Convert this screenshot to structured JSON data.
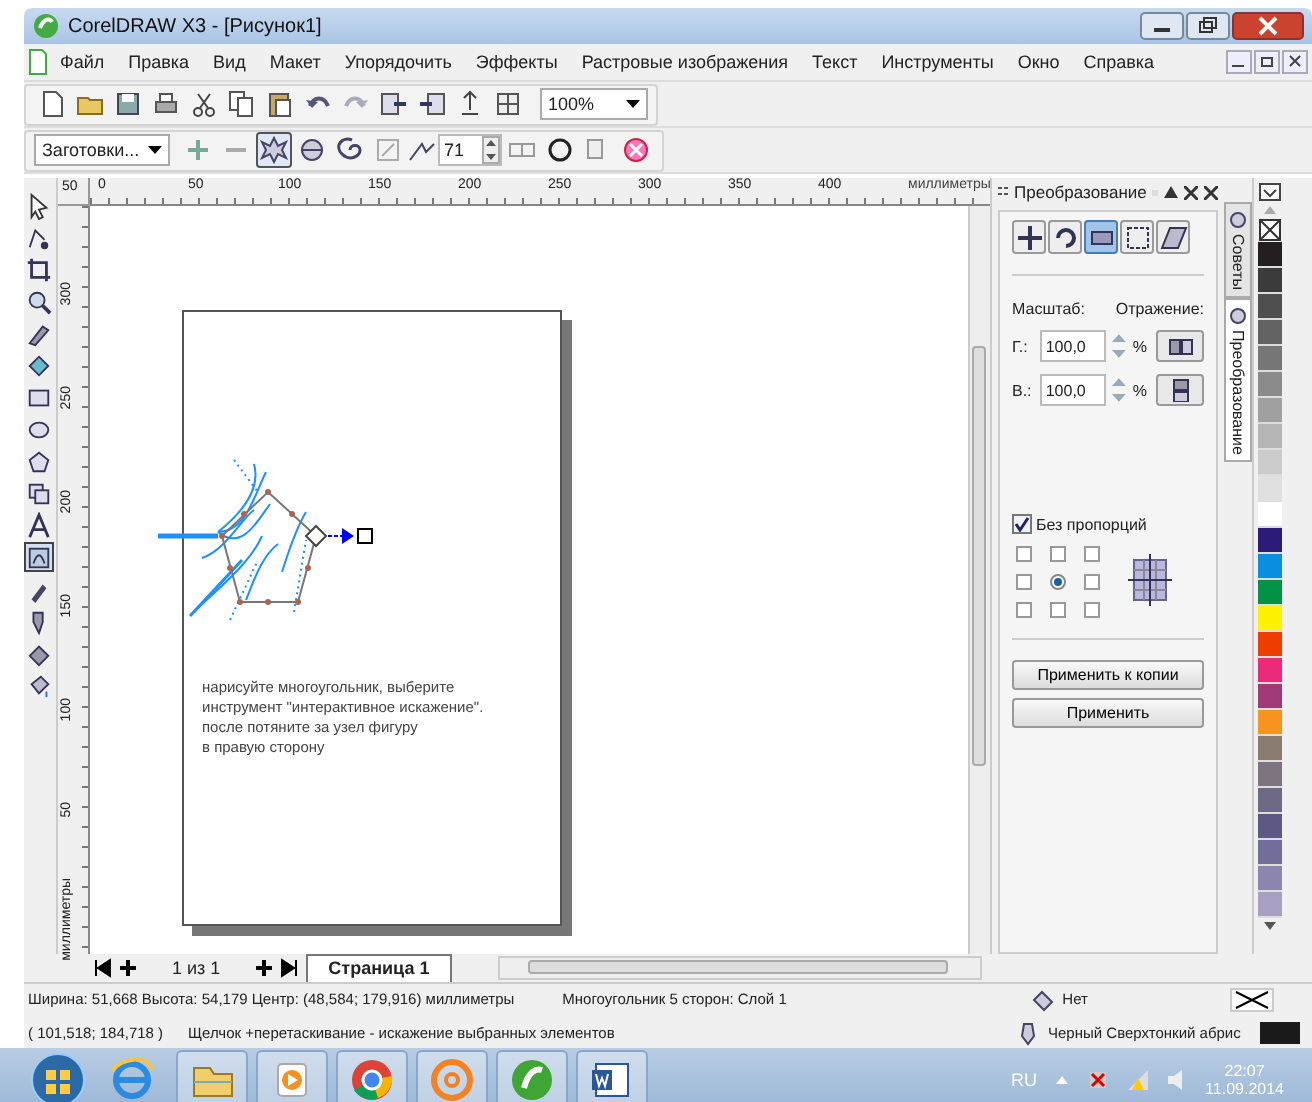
{
  "window": {
    "title": "CorelDRAW X3 - [Рисунок1]"
  },
  "menu": [
    "Файл",
    "Правка",
    "Вид",
    "Макет",
    "Упорядочить",
    "Эффекты",
    "Растровые изображения",
    "Текст",
    "Инструменты",
    "Окно",
    "Справка"
  ],
  "toolbar": {
    "zoom": "100%"
  },
  "property_bar": {
    "presets": "Заготовки...",
    "modes": [
      {
        "selected": true
      },
      {
        "selected": false
      },
      {
        "selected": false
      }
    ],
    "amplitude": "71"
  },
  "toolbox": {
    "tools": [
      {
        "selected": false
      },
      {
        "selected": false
      },
      {
        "selected": false
      },
      {
        "selected": false
      },
      {
        "selected": false
      },
      {
        "selected": false
      },
      {
        "selected": false
      },
      {
        "selected": false
      },
      {
        "selected": false
      },
      {
        "selected": false
      },
      {
        "selected": false
      },
      {
        "selected": true
      },
      {
        "selected": false
      },
      {
        "selected": false
      },
      {
        "selected": false
      },
      {
        "selected": false
      }
    ]
  },
  "rulers": {
    "corner": "50",
    "horizontal": [
      "0",
      "50",
      "100",
      "150",
      "200",
      "250",
      "300",
      "350",
      "400"
    ],
    "horizontal_unit": "миллиметры",
    "vertical": [
      "300",
      "250",
      "200",
      "150",
      "100",
      "50"
    ],
    "vertical_unit": "миллиметры"
  },
  "page": {
    "text": "нарисуйте многоугольник, выберите\nинструмент \"интерактивное искажение\".\nпосле потяните за узел фигуру\nв правую сторону"
  },
  "docker": {
    "title": "Преобразование",
    "modes": [
      {
        "selected": false
      },
      {
        "selected": false
      },
      {
        "selected": true
      },
      {
        "selected": false
      },
      {
        "selected": false
      }
    ],
    "scale_label": "Масштаб:",
    "mirror_label": "Отражение:",
    "fields": [
      {
        "label": "Г.:",
        "value": "100,0",
        "unit": "%"
      },
      {
        "label": "В.:",
        "value": "100,0",
        "unit": "%"
      }
    ],
    "proportional": {
      "label": "Без пропорций",
      "checked": true
    },
    "anchors": [
      {
        "selected": false
      },
      {
        "selected": false
      },
      {
        "selected": false
      },
      {
        "selected": false
      },
      {
        "selected": true
      },
      {
        "selected": false
      },
      {
        "selected": false
      },
      {
        "selected": false
      },
      {
        "selected": false
      }
    ],
    "buttons": [
      "Применить к копии",
      "Применить"
    ]
  },
  "docker_tabs": [
    {
      "label": "Советы",
      "selected": false
    },
    {
      "label": "Преобразование",
      "selected": true
    }
  ],
  "palette": [
    {
      "kind": "none"
    },
    {
      "kind": "color",
      "color": "#231f20"
    },
    {
      "kind": "color",
      "color": "#3b3b3b"
    },
    {
      "kind": "color",
      "color": "#4f4f4f"
    },
    {
      "kind": "color",
      "color": "#636363"
    },
    {
      "kind": "color",
      "color": "#777777"
    },
    {
      "kind": "color",
      "color": "#8b8b8b"
    },
    {
      "kind": "color",
      "color": "#a0a0a0"
    },
    {
      "kind": "color",
      "color": "#b5b5b5"
    },
    {
      "kind": "color",
      "color": "#cbcbcb"
    },
    {
      "kind": "color",
      "color": "#e0e0e0"
    },
    {
      "kind": "color",
      "color": "#ffffff"
    },
    {
      "kind": "color",
      "color": "#2e1a78"
    },
    {
      "kind": "color",
      "color": "#0a8ee0"
    },
    {
      "kind": "color",
      "color": "#009245"
    },
    {
      "kind": "color",
      "color": "#fff200"
    },
    {
      "kind": "color",
      "color": "#ee3e00"
    },
    {
      "kind": "color",
      "color": "#ec2a7a"
    },
    {
      "kind": "color",
      "color": "#a03a79"
    },
    {
      "kind": "color",
      "color": "#f7941d"
    },
    {
      "kind": "color",
      "color": "#8a7b6f"
    },
    {
      "kind": "color",
      "color": "#7d7480"
    },
    {
      "kind": "color",
      "color": "#6e6a86"
    },
    {
      "kind": "color",
      "color": "#5c5a84"
    },
    {
      "kind": "color",
      "color": "#736d9b"
    },
    {
      "kind": "color",
      "color": "#8c86b0"
    },
    {
      "kind": "color",
      "color": "#a89fc2"
    }
  ],
  "pager": {
    "count": "1 из 1",
    "tab": "Страница 1"
  },
  "status_bar": {
    "dimensions": "Ширина: 51,668 Высота: 54,179 Центр: (48,584; 179,916) миллиметры",
    "object": "Многоугольник  5 сторон: Слой 1",
    "fill": "Нет",
    "cursor": "( 101,518; 184,718 )",
    "hint": "Щелчок +перетаскивание - искажение выбранных элементов",
    "outline": "Черный  Сверхтонкий абрис"
  },
  "taskbar": {
    "apps": [
      {
        "kind": "browser-e",
        "running": false
      },
      {
        "kind": "folder",
        "running": true
      },
      {
        "kind": "media",
        "running": true
      },
      {
        "kind": "chrome",
        "running": true
      },
      {
        "kind": "mail",
        "running": true
      },
      {
        "kind": "corel",
        "running": true
      },
      {
        "kind": "word",
        "running": true
      }
    ],
    "language": "RU",
    "time": "22:07",
    "date": "11.09.2014"
  }
}
